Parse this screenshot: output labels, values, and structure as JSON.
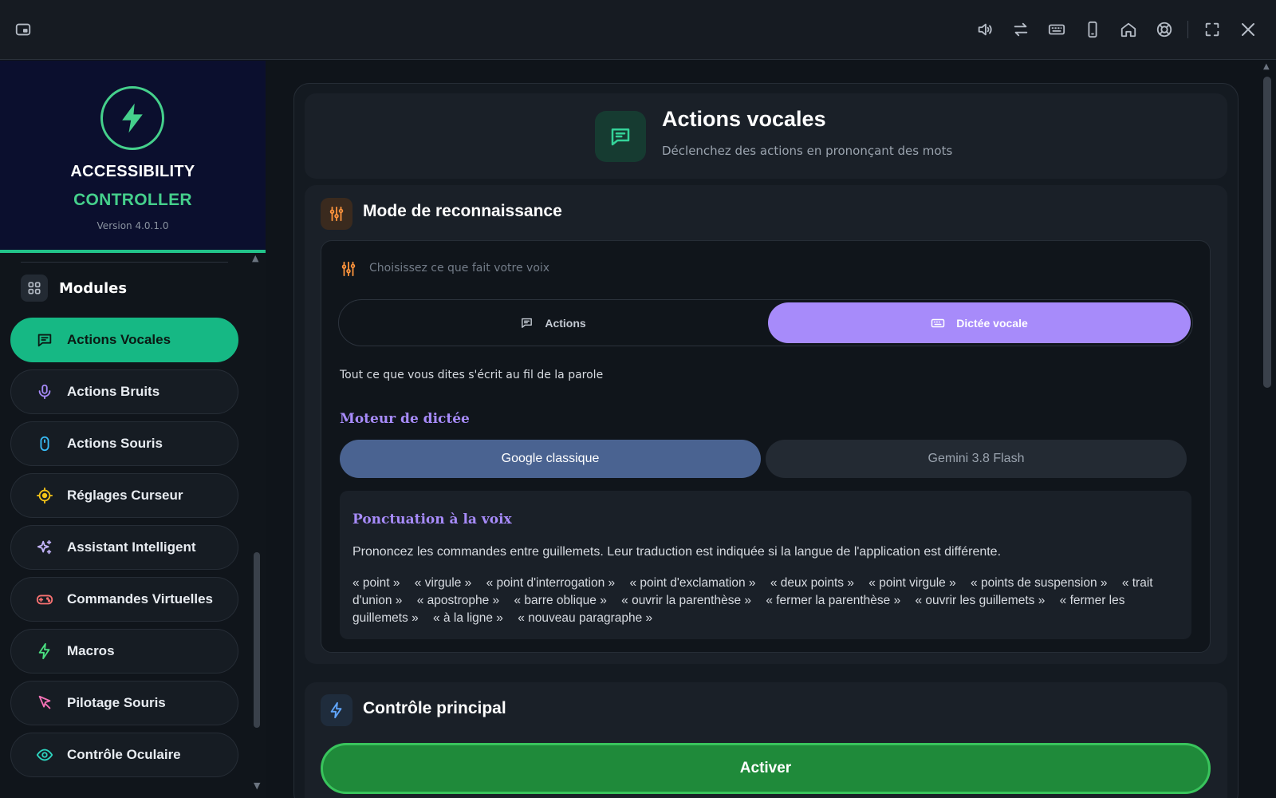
{
  "app": {
    "brand_line1": "ACCESSIBILITY",
    "brand_line2": "CONTROLLER",
    "version": "Version 4.0.1.0"
  },
  "topbar": {
    "icons": [
      "pip-icon",
      "volume-icon",
      "swap-icon",
      "keyboard-icon",
      "phone-icon",
      "home-icon",
      "help-icon",
      "fullscreen-icon",
      "close-icon"
    ]
  },
  "sidebar": {
    "section_label": "Modules",
    "items": [
      {
        "label": "Actions Vocales",
        "icon": "message-icon",
        "color": "#0b1a14",
        "active": true
      },
      {
        "label": "Actions Bruits",
        "icon": "mic-icon",
        "color": "#a78bfa"
      },
      {
        "label": "Actions Souris",
        "icon": "mouse-icon",
        "color": "#38bdf8"
      },
      {
        "label": "Réglages Curseur",
        "icon": "crosshair-icon",
        "color": "#f5c518"
      },
      {
        "label": "Assistant Intelligent",
        "icon": "sparkles-icon",
        "color": "#c4b5fd"
      },
      {
        "label": "Commandes Virtuelles",
        "icon": "gamepad-icon",
        "color": "#f87171"
      },
      {
        "label": "Macros",
        "icon": "bolt-icon",
        "color": "#4ade80"
      },
      {
        "label": "Pilotage Souris",
        "icon": "pointer-icon",
        "color": "#f472b6"
      },
      {
        "label": "Contrôle Oculaire",
        "icon": "eye-icon",
        "color": "#2dd4bf"
      }
    ]
  },
  "header": {
    "title": "Actions vocales",
    "subtitle": "Déclenchez des actions en prononçant des mots"
  },
  "mode": {
    "title": "Mode de reconnaissance",
    "choose_label": "Choisissez ce que fait votre voix",
    "option_actions": "Actions",
    "option_dictation": "Dictée vocale",
    "selected": "Dictée vocale",
    "description": "Tout ce que vous dites s'écrit au fil de la parole",
    "engine_title": "Moteur de dictée",
    "engine_google": "Google classique",
    "engine_gemini": "Gemini 3.8 Flash",
    "engine_selected": "Google classique"
  },
  "punctuation": {
    "title": "Ponctuation à la voix",
    "description": "Prononcez les commandes entre guillemets. Leur traduction est indiquée si la langue de l'application est différente.",
    "commands": [
      "« point »",
      "« virgule »",
      "« point d'interrogation »",
      "« point d'exclamation »",
      "« deux points »",
      "« point virgule »",
      "« points de suspension »",
      "« trait d'union »",
      "« apostrophe »",
      "« barre oblique »",
      "« ouvrir la parenthèse »",
      "« fermer la parenthèse »",
      "« ouvrir les guillemets »",
      "« fermer les guillemets »",
      "« à la ligne »",
      "« nouveau paragraphe »"
    ]
  },
  "control": {
    "title": "Contrôle principal",
    "activate_label": "Activer"
  },
  "colors": {
    "accent_green": "#16b884",
    "accent_purple": "#a78bfa",
    "engine_selected_bg": "#4a6391",
    "activate_bg": "#1f8a3a"
  }
}
